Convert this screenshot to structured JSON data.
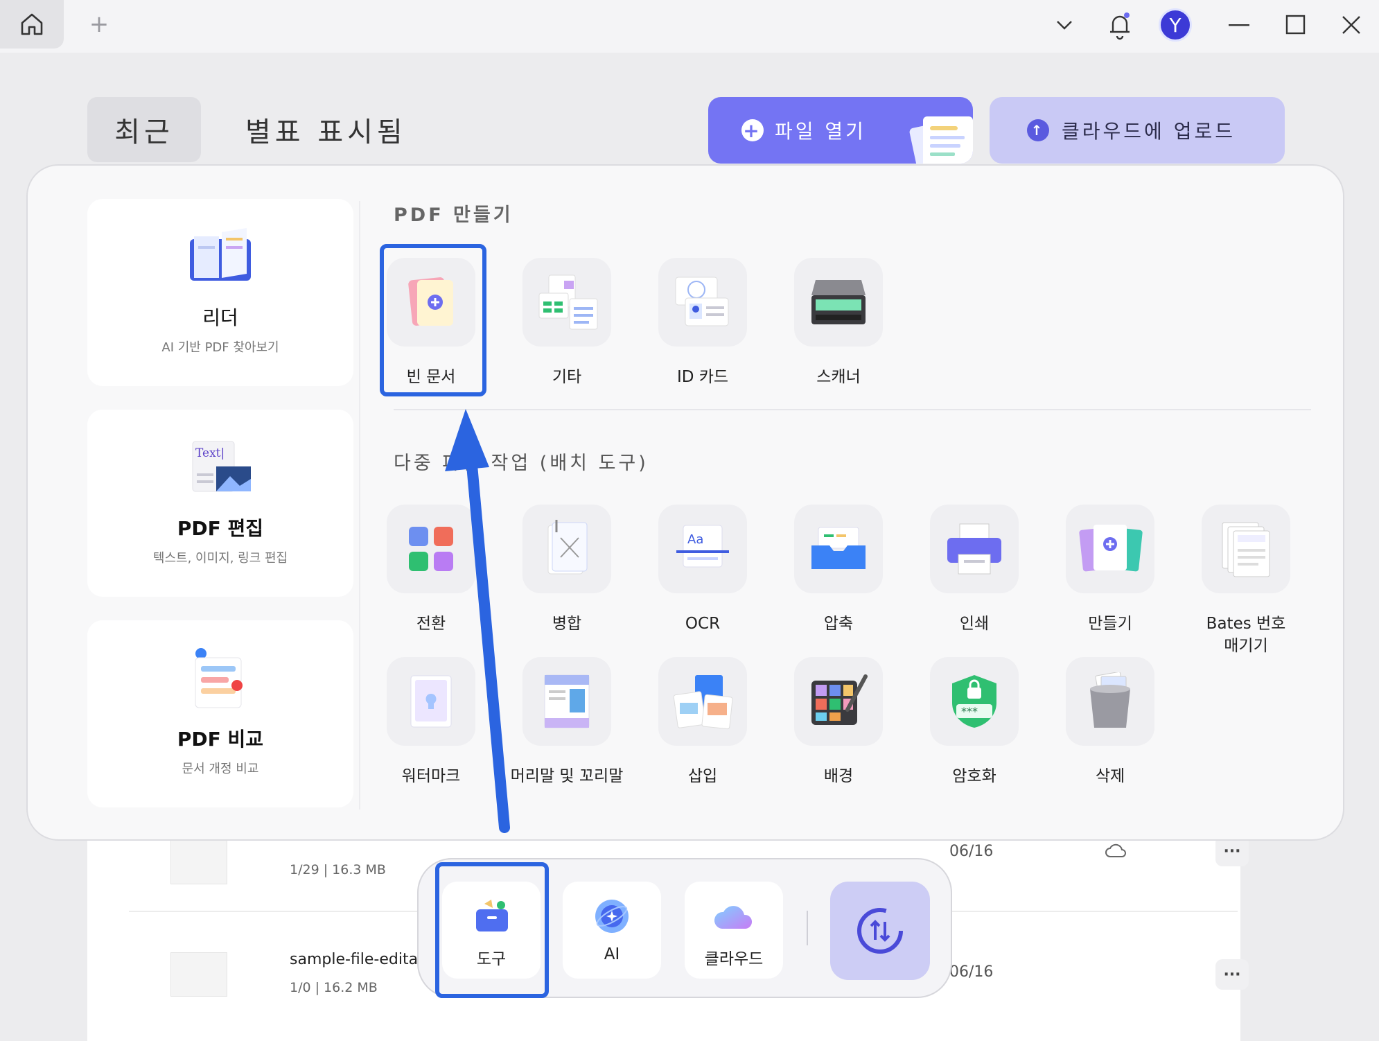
{
  "titlebar": {
    "avatar_letter": "Y"
  },
  "tabs": {
    "recent": "최근",
    "starred": "별표 표시됨"
  },
  "actions": {
    "open_file": "파일 열기",
    "upload_cloud": "클라우드에 업로드"
  },
  "left_cards": [
    {
      "title": "리더",
      "subtitle": "AI 기반 PDF 찾아보기"
    },
    {
      "title": "PDF 편집",
      "subtitle": "텍스트, 이미지, 링크 편집",
      "thumb_text": "Text|"
    },
    {
      "title": "PDF 비교",
      "subtitle": "문서 개정 비교"
    }
  ],
  "create_section": {
    "title": "PDF 만들기",
    "tools": [
      "빈 문서",
      "기타",
      "ID 카드",
      "스캐너"
    ]
  },
  "batch_section": {
    "title": "다중 파일 작업 (배치 도구)",
    "row1": [
      "전환",
      "병합",
      "OCR",
      "압축",
      "인쇄",
      "만들기",
      "Bates 번호\n매기기"
    ],
    "row2": [
      "워터마크",
      "머리말 및 꼬리말",
      "삽입",
      "배경",
      "암호화",
      "삭제"
    ]
  },
  "files": [
    {
      "meta": "1/29 | 16.3 MB",
      "date": "06/16"
    },
    {
      "name": "sample-file-editable_Co",
      "meta": "1/0 | 16.2 MB",
      "date": "06/16"
    }
  ],
  "dock": {
    "tools": "도구",
    "ai": "AI",
    "cloud": "클라우드"
  },
  "colors": {
    "accent": "#7474f3",
    "highlight": "#2b64e0"
  }
}
